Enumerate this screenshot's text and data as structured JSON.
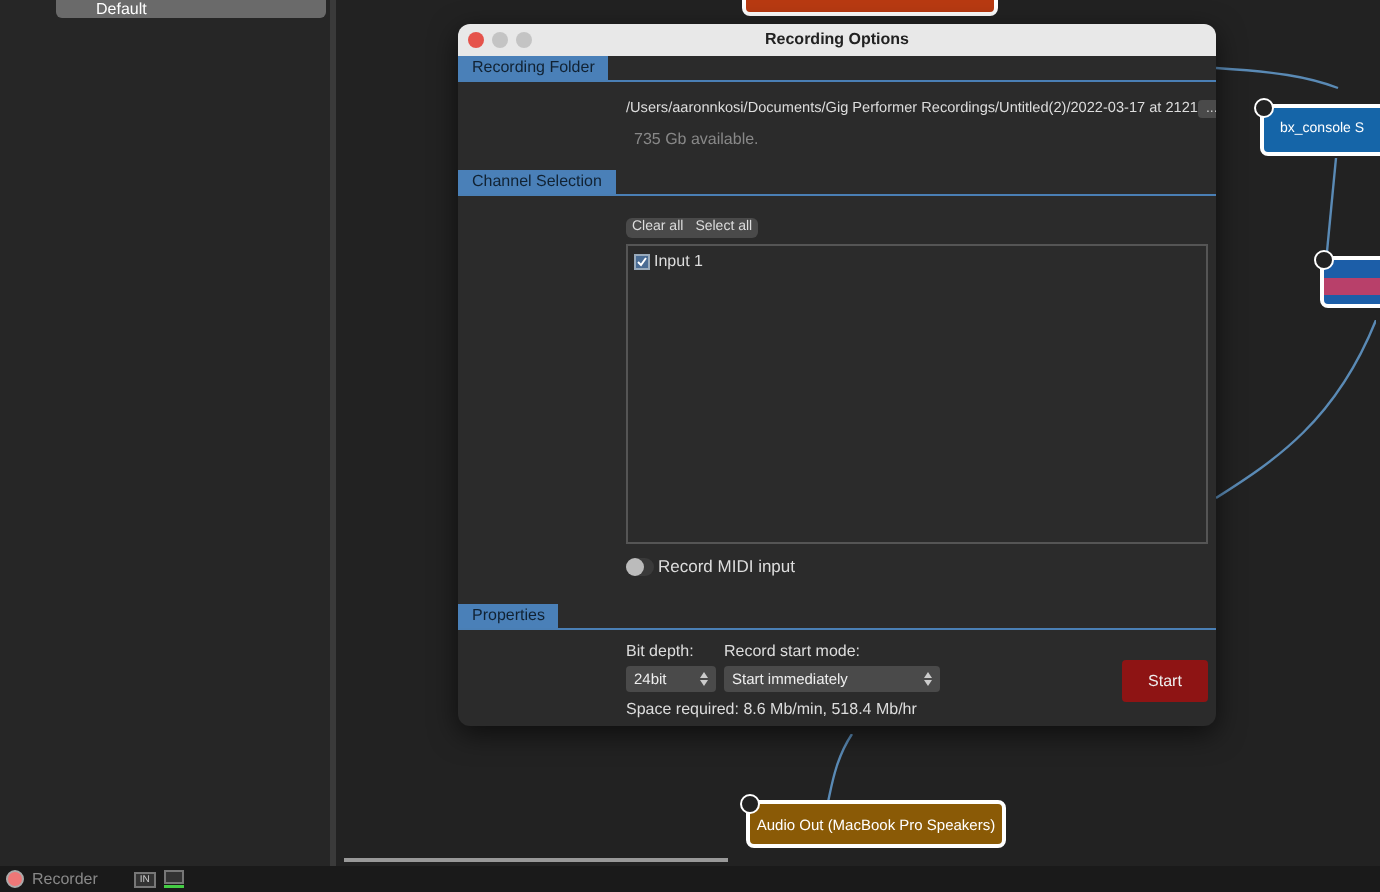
{
  "sidebar": {
    "items": [
      {
        "label": "Default",
        "selected": true
      }
    ]
  },
  "canvas": {
    "nodes": [
      {
        "kind": "top",
        "color": "#b83a12"
      },
      {
        "kind": "console",
        "label": "bx_console S",
        "color": "#1565a8"
      },
      {
        "kind": "meter",
        "color": "#1c5ea8"
      },
      {
        "kind": "output",
        "label": "Audio Out (MacBook Pro Speakers)",
        "color": "#8a5a06"
      }
    ]
  },
  "dialog": {
    "title": "Recording Options",
    "recording_folder": {
      "title": "Recording Folder",
      "path": "/Users/aaronnkosi/Documents/Gig Performer Recordings/Untitled(2)/2022-03-17 at 2121",
      "browse_button": "...",
      "free_space": "735 Gb available."
    },
    "channel_selection": {
      "title": "Channel Selection",
      "buttons": [
        "Clear all",
        "Select all"
      ],
      "channels": [
        {
          "label": "Input 1",
          "checked": true
        }
      ],
      "record_midi": {
        "label": "Record MIDI input",
        "on": false
      }
    },
    "properties": {
      "title": "Properties",
      "bit_depth": {
        "label": "Bit depth:",
        "value": "24bit"
      },
      "start_mode": {
        "label": "Record start mode:",
        "value": "Start immediately"
      },
      "space_required": "Space required: 8.6 Mb/min, 518.4 Mb/hr",
      "start_button": "Start"
    }
  },
  "status_bar": {
    "recorder": "Recorder",
    "in_button": "IN"
  }
}
